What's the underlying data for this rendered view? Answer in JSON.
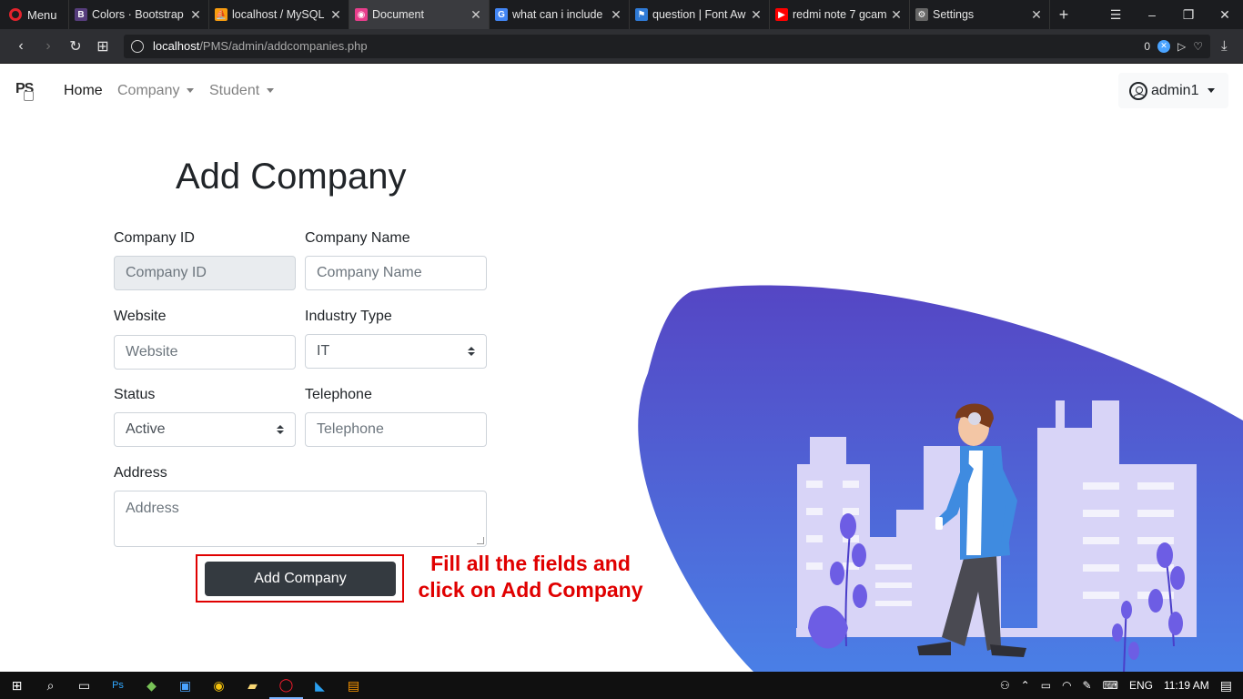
{
  "browser": {
    "menu_label": "Menu",
    "tabs": [
      {
        "title": "Colors · Bootstrap",
        "icon": "bootstrap-icon",
        "color": "#563d7c",
        "glyph": "B"
      },
      {
        "title": "localhost / MySQL",
        "icon": "phpmyadmin-icon",
        "color": "#f89c0e",
        "glyph": "⛵"
      },
      {
        "title": "Document",
        "icon": "document-icon",
        "color": "#e83e8c",
        "glyph": "◉"
      },
      {
        "title": "what can i include",
        "icon": "google-icon",
        "color": "#4285f4",
        "glyph": "G"
      },
      {
        "title": "question | Font Aw",
        "icon": "flag-icon",
        "color": "#2f7ad6",
        "glyph": "⚑"
      },
      {
        "title": "redmi note 7 gcam",
        "icon": "youtube-icon",
        "color": "#ff0000",
        "glyph": "▶"
      },
      {
        "title": "Settings",
        "icon": "gear-icon",
        "color": "#666666",
        "glyph": "⚙"
      }
    ],
    "url_host": "localhost",
    "url_path": "/PMS/admin/addcompanies.php",
    "adblock_count": "0"
  },
  "navbar": {
    "brand": "PS",
    "links": [
      "Home",
      "Company",
      "Student"
    ],
    "user": "admin1"
  },
  "form": {
    "title": "Add Company",
    "company_id": {
      "label": "Company ID",
      "placeholder": "Company ID"
    },
    "company_name": {
      "label": "Company Name",
      "placeholder": "Company Name"
    },
    "website": {
      "label": "Website",
      "placeholder": "Website"
    },
    "industry_type": {
      "label": "Industry Type",
      "value": "IT"
    },
    "status": {
      "label": "Status",
      "value": "Active"
    },
    "telephone": {
      "label": "Telephone",
      "placeholder": "Telephone"
    },
    "address": {
      "label": "Address",
      "placeholder": "Address"
    },
    "submit_label": "Add Company"
  },
  "annotation": {
    "line1": "Fill all the fields and",
    "line2": "click on Add Company",
    "color": "#e00000"
  },
  "taskbar": {
    "language": "ENG",
    "time": "11:19 AM"
  },
  "colors": {
    "button_dark": "#343a40",
    "blob_top": "#5546c4",
    "blob_bottom": "#4a7fe6",
    "buildings": "#d8d4f7"
  }
}
